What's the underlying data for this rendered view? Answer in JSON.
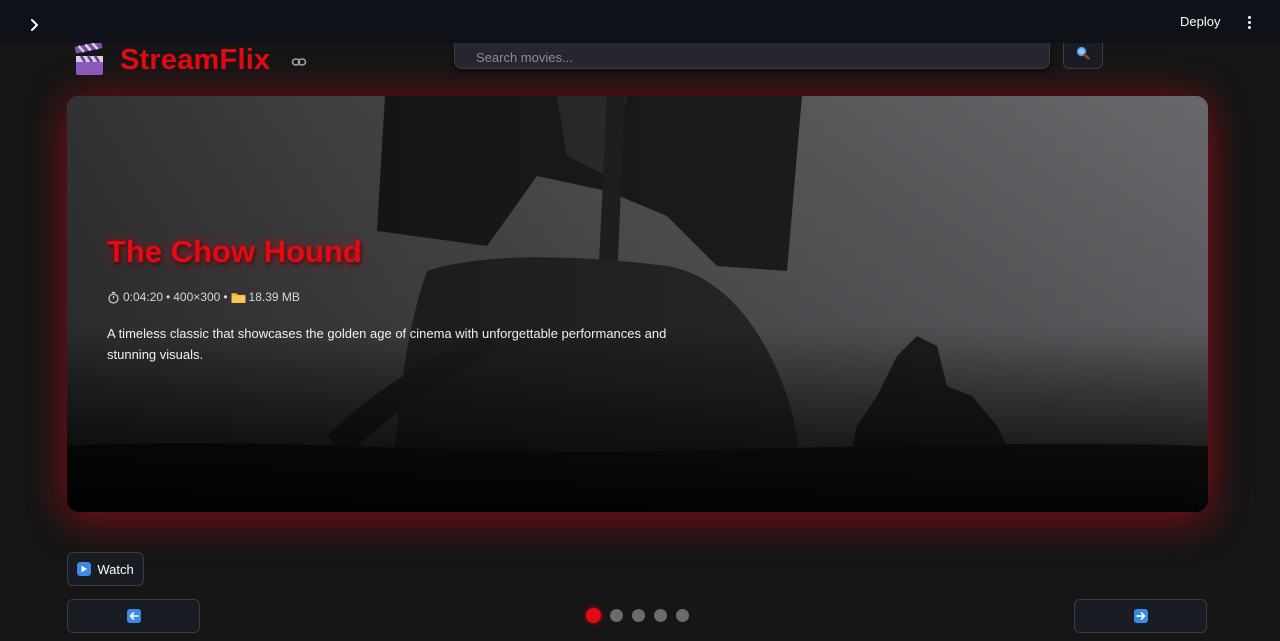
{
  "toolbar": {
    "sidebar_toggle_icon": "chevron-right-icon",
    "deploy_label": "Deploy",
    "menu_icon": "vertical-ellipsis-icon"
  },
  "header": {
    "logo_icon": "clapper-board-icon",
    "app_title": "StreamFlix",
    "anchor_icon": "link-icon",
    "search_placeholder": "Search movies...",
    "search_value": "",
    "search_button_icon": "magnifier-icon"
  },
  "hero": {
    "title": "The Chow Hound",
    "duration": "0:04:20",
    "separator": "•",
    "resolution": "400×300",
    "file_size": "18.39 MB",
    "duration_icon": "stopwatch-icon",
    "size_icon": "folder-icon",
    "description": "A timeless classic that showcases the golden age of cinema with unforgettable performances and stunning visuals."
  },
  "controls": {
    "watch_label": "Watch",
    "watch_icon": "play-button-icon",
    "prev_icon": "left-arrow-icon",
    "next_icon": "right-arrow-icon",
    "slide_count": 5,
    "active_slide": 1
  },
  "colors": {
    "brand": "#e50914",
    "background": "#161616",
    "toolbar": "#0e1117",
    "button_bg": "#1a1c24",
    "input_bg": "#262730",
    "dot_inactive": "#6b6b6b",
    "emoji_blue": "#3b8ae6"
  }
}
